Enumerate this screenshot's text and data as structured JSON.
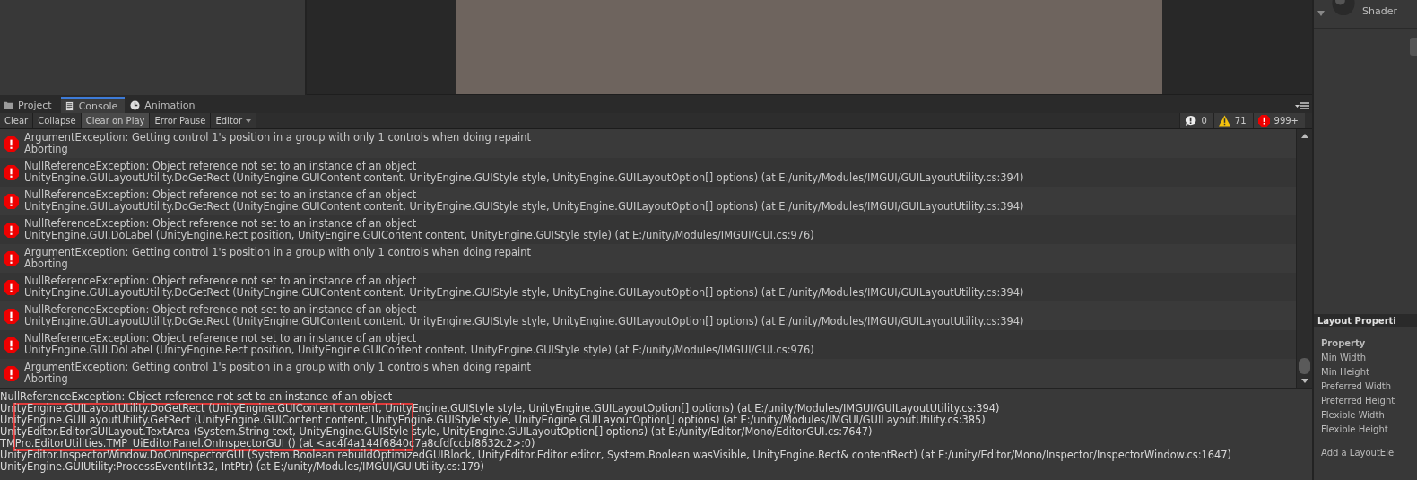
{
  "inspector": {
    "shader_label": "Shader"
  },
  "tabs": [
    {
      "label": "Project",
      "kind": "folder",
      "selected": false
    },
    {
      "label": "Console",
      "kind": "document",
      "selected": true
    },
    {
      "label": "Animation",
      "kind": "clock",
      "selected": false
    }
  ],
  "toolbar": [
    {
      "label": "Clear",
      "kind": "button",
      "on": false
    },
    {
      "label": "Collapse",
      "kind": "toggle",
      "on": false
    },
    {
      "label": "Clear on Play",
      "kind": "toggle",
      "on": true
    },
    {
      "label": "Error Pause",
      "kind": "toggle",
      "on": false
    },
    {
      "label": "Editor",
      "kind": "dropdown",
      "on": false
    }
  ],
  "counters": [
    {
      "kind": "info",
      "count": "0"
    },
    {
      "kind": "warning",
      "count": "71"
    },
    {
      "kind": "error",
      "count": "999+"
    }
  ],
  "log": [
    {
      "kind": "error",
      "lines": [
        "ArgumentException: Getting control 1's position in a group with only 1 controls when doing repaint",
        "Aborting"
      ]
    },
    {
      "kind": "error",
      "lines": [
        "NullReferenceException: Object reference not set to an instance of an object",
        "UnityEngine.GUILayoutUtility.DoGetRect (UnityEngine.GUIContent content, UnityEngine.GUIStyle style, UnityEngine.GUILayoutOption[] options) (at E:/unity/Modules/IMGUI/GUILayoutUtility.cs:394)"
      ]
    },
    {
      "kind": "error",
      "lines": [
        "NullReferenceException: Object reference not set to an instance of an object",
        "UnityEngine.GUILayoutUtility.DoGetRect (UnityEngine.GUIContent content, UnityEngine.GUIStyle style, UnityEngine.GUILayoutOption[] options) (at E:/unity/Modules/IMGUI/GUILayoutUtility.cs:394)"
      ]
    },
    {
      "kind": "error",
      "lines": [
        "NullReferenceException: Object reference not set to an instance of an object",
        "UnityEngine.GUI.DoLabel (UnityEngine.Rect position, UnityEngine.GUIContent content, UnityEngine.GUIStyle style) (at E:/unity/Modules/IMGUI/GUI.cs:976)"
      ]
    },
    {
      "kind": "error",
      "lines": [
        "ArgumentException: Getting control 1's position in a group with only 1 controls when doing repaint",
        "Aborting"
      ]
    },
    {
      "kind": "error",
      "lines": [
        "NullReferenceException: Object reference not set to an instance of an object",
        "UnityEngine.GUILayoutUtility.DoGetRect (UnityEngine.GUIContent content, UnityEngine.GUIStyle style, UnityEngine.GUILayoutOption[] options) (at E:/unity/Modules/IMGUI/GUILayoutUtility.cs:394)"
      ]
    },
    {
      "kind": "error",
      "lines": [
        "NullReferenceException: Object reference not set to an instance of an object",
        "UnityEngine.GUILayoutUtility.DoGetRect (UnityEngine.GUIContent content, UnityEngine.GUIStyle style, UnityEngine.GUILayoutOption[] options) (at E:/unity/Modules/IMGUI/GUILayoutUtility.cs:394)"
      ]
    },
    {
      "kind": "error",
      "lines": [
        "NullReferenceException: Object reference not set to an instance of an object",
        "UnityEngine.GUI.DoLabel (UnityEngine.Rect position, UnityEngine.GUIContent content, UnityEngine.GUIStyle style) (at E:/unity/Modules/IMGUI/GUI.cs:976)"
      ]
    },
    {
      "kind": "error",
      "lines": [
        "ArgumentException: Getting control 1's position in a group with only 1 controls when doing repaint",
        "Aborting"
      ]
    }
  ],
  "details": {
    "lines": [
      "NullReferenceException: Object reference not set to an instance of an object",
      "UnityEngine.GUILayoutUtility.DoGetRect (UnityEngine.GUIContent content, UnityEngine.GUIStyle style, UnityEngine.GUILayoutOption[] options) (at E:/unity/Modules/IMGUI/GUILayoutUtility.cs:394)",
      "UnityEngine.GUILayoutUtility.GetRect (UnityEngine.GUIContent content, UnityEngine.GUIStyle style, UnityEngine.GUILayoutOption[] options) (at E:/unity/Modules/IMGUI/GUILayoutUtility.cs:385)",
      "UnityEditor.EditorGUILayout.TextArea (System.String text, UnityEngine.GUIStyle style, UnityEngine.GUILayoutOption[] options) (at E:/unity/Editor/Mono/EditorGUI.cs:7647)",
      "TMPro.EditorUtilities.TMP_UiEditorPanel.OnInspectorGUI () (at <ac4f4a144f6840c7a8cfdfccbf8632c2>:0)",
      "UnityEditor.InspectorWindow.DoOnInspectorGUI (System.Boolean rebuildOptimizedGUIBlock, UnityEditor.Editor editor, System.Boolean wasVisible, UnityEngine.Rect& contentRect) (at E:/unity/Editor/Mono/Inspector/InspectorWindow.cs:1647)",
      "UnityEngine.GUIUtility:ProcessEvent(Int32, IntPtr) (at E:/unity/Modules/IMGUI/GUIUtility.cs:179)"
    ],
    "annotation": {
      "kind": "rectangle"
    }
  },
  "layout_properties": {
    "title": "Layout Properti",
    "header": "Property",
    "rows": [
      "Min Width",
      "Min Height",
      "Preferred Width",
      "Preferred Height",
      "Flexible Width",
      "Flexible Height"
    ],
    "footer": "Add a LayoutEle"
  }
}
